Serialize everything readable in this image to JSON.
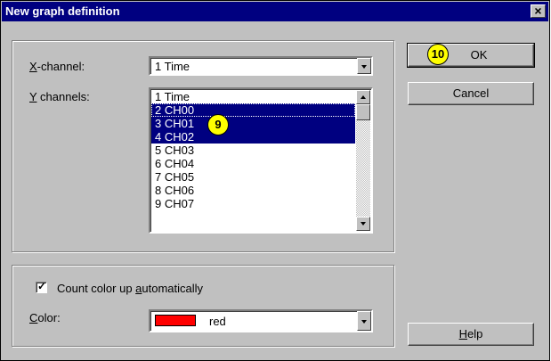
{
  "dialog": {
    "title": "New graph definition",
    "close_symbol": "×"
  },
  "x_channel": {
    "label_prefix": "",
    "label_mnemonic": "X",
    "label_rest": "-channel:",
    "value": "1  Time"
  },
  "y_channels": {
    "label_mnemonic": "Y",
    "label_rest": " channels:",
    "items": [
      {
        "text": "1  Time",
        "selected": false
      },
      {
        "text": "2  CH00",
        "selected": true
      },
      {
        "text": "3  CH01",
        "selected": true
      },
      {
        "text": "4  CH02",
        "selected": true
      },
      {
        "text": "5  CH03",
        "selected": false
      },
      {
        "text": "6  CH04",
        "selected": false
      },
      {
        "text": "7  CH05",
        "selected": false
      },
      {
        "text": "8  CH06",
        "selected": false
      },
      {
        "text": "9  CH07",
        "selected": false
      }
    ]
  },
  "color_options": {
    "checkbox_label_before": "Count color up ",
    "checkbox_label_mnemonic": "a",
    "checkbox_label_after": "utomatically",
    "checkbox_checked": true,
    "color_label_mnemonic": "C",
    "color_label_rest": "olor:",
    "color_value": "red",
    "swatch_color": "#ff0000"
  },
  "buttons": {
    "ok": "OK",
    "cancel": "Cancel",
    "help_mnemonic": "H",
    "help_rest": "elp"
  },
  "annotations": {
    "badge_ok": "10",
    "badge_list": "9",
    "badge_color": "#ffff00"
  }
}
